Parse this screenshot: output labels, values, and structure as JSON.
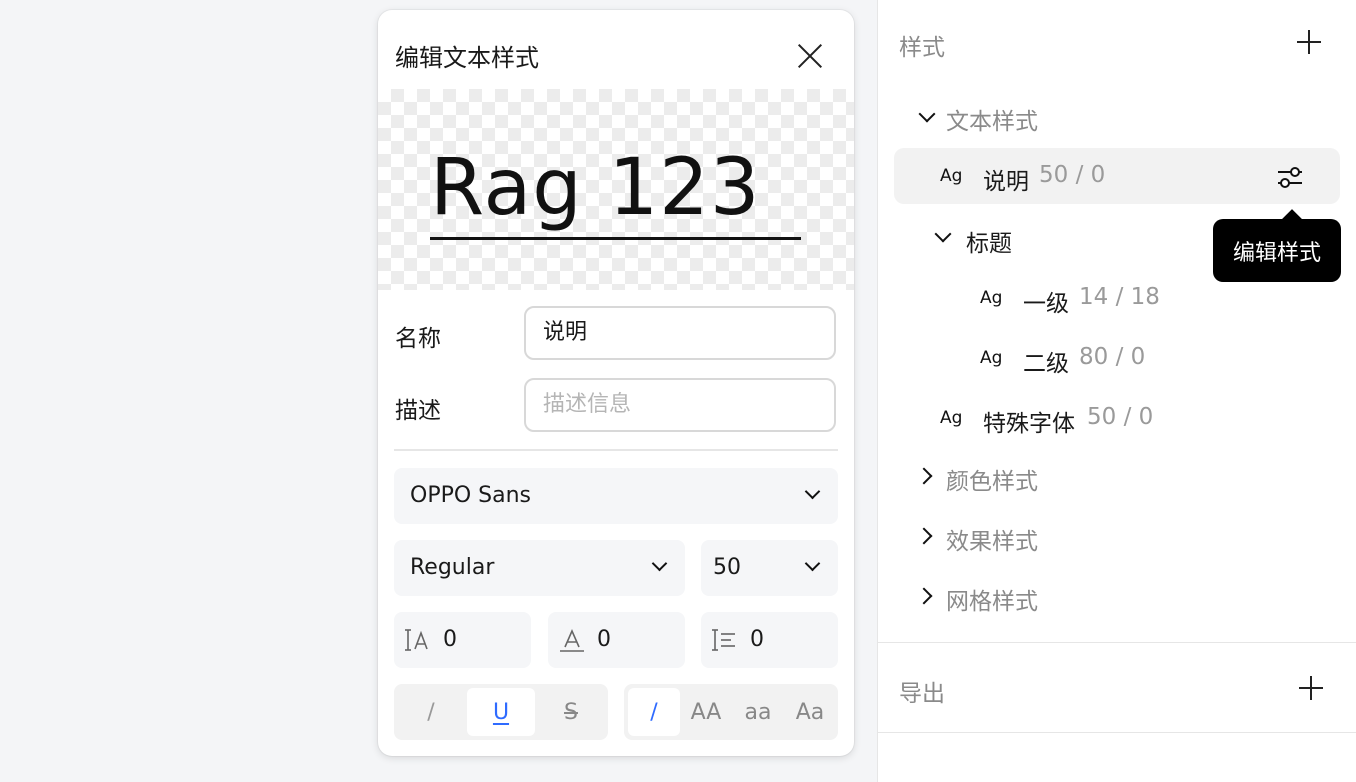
{
  "dialog": {
    "title": "编辑文本样式",
    "preview_text": "Rag 123",
    "name_label": "名称",
    "name_value": "说明",
    "desc_label": "描述",
    "desc_placeholder": "描述信息",
    "font_family": "OPPO Sans",
    "font_weight": "Regular",
    "font_size": "50",
    "letter_spacing": "0",
    "baseline": "0",
    "paragraph_spacing": "0",
    "decoration": {
      "none": "/",
      "underline": "U",
      "strike": "S",
      "selected": "underline"
    },
    "case": {
      "none": "/",
      "upper": "AA",
      "lower": "aa",
      "title": "Aa",
      "selected": "none"
    }
  },
  "panel": {
    "styles_title": "样式",
    "text_styles_label": "文本样式",
    "items": [
      {
        "ag": "Ag",
        "name": "说明",
        "meta": "50 / 0"
      },
      {
        "ag": "Ag",
        "name": "一级",
        "meta": "14 / 18"
      },
      {
        "ag": "Ag",
        "name": "二级",
        "meta": "80 / 0"
      },
      {
        "ag": "Ag",
        "name": "特殊字体",
        "meta": "50 / 0"
      }
    ],
    "heading_group": "标题",
    "tooltip": "编辑样式",
    "color_styles_label": "颜色样式",
    "effect_styles_label": "效果样式",
    "grid_styles_label": "网格样式",
    "export_title": "导出"
  },
  "colors": {
    "accent": "#2f6bff"
  }
}
